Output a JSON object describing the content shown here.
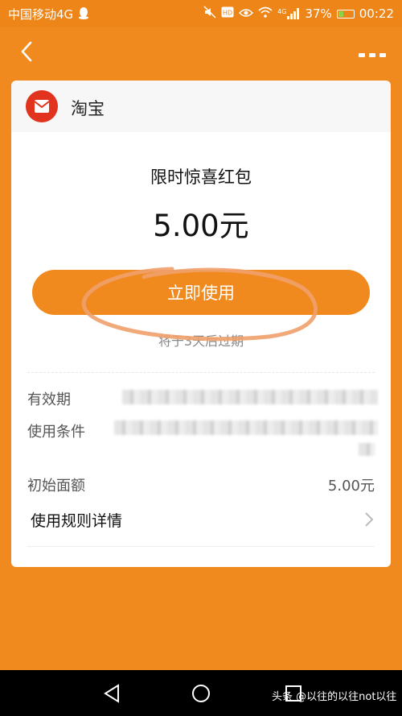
{
  "status_bar": {
    "carrier": "中国移动4G",
    "signal_label": "4G",
    "battery": "37%",
    "time": "00:22"
  },
  "nav": {
    "back_icon": "chevron-left-icon",
    "more_icon": "more-dots-icon"
  },
  "shop": {
    "name": "淘宝",
    "logo_icon": "taobao-logo-icon"
  },
  "coupon": {
    "title": "限时惊喜红包",
    "amount": "5.00元",
    "use_button": "立即使用",
    "expire_note": "将于3天后过期"
  },
  "details": {
    "valid_label": "有效期",
    "condition_label": "使用条件",
    "face_value_label": "初始面额",
    "face_value": "5.00元",
    "rules_label": "使用规则详情"
  },
  "watermark": "头条 @以往的以往not以往",
  "colors": {
    "accent": "#F08A1E",
    "logo_red": "#E2331E"
  }
}
